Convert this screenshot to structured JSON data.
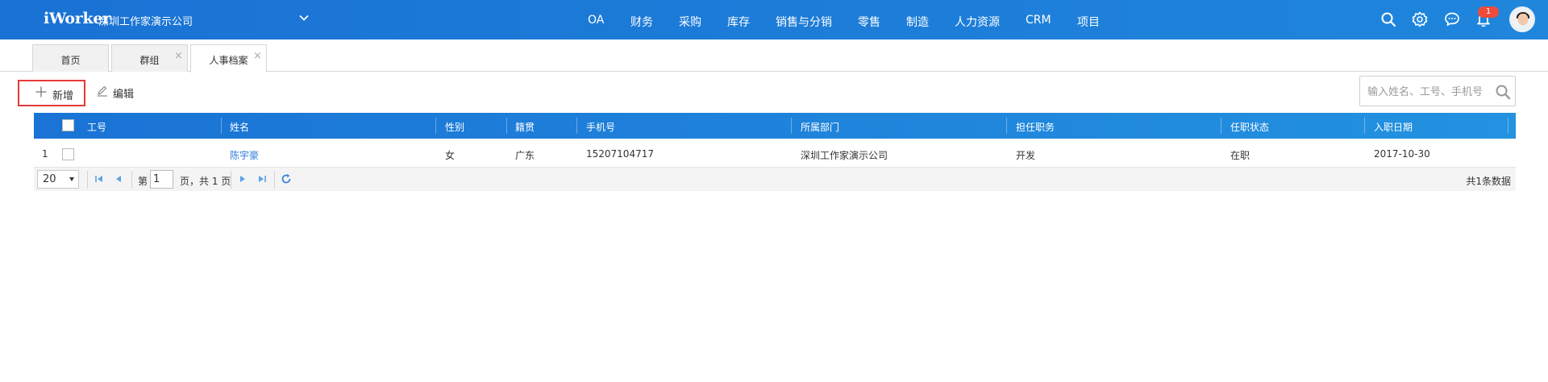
{
  "header": {
    "logo": "iWorker",
    "company": "深圳工作家演示公司",
    "nav": [
      "OA",
      "财务",
      "采购",
      "库存",
      "销售与分销",
      "零售",
      "制造",
      "人力资源",
      "CRM",
      "项目"
    ],
    "notification_count": "1",
    "colors": {
      "bar": "#1a72d4",
      "badge": "#f04b3a"
    }
  },
  "tabs": [
    {
      "label": "首页"
    },
    {
      "label": "群组"
    },
    {
      "label": "人事档案"
    }
  ],
  "toolbar": {
    "add_label": "新增",
    "edit_label": "编辑",
    "search_placeholder": "输入姓名、工号、手机号"
  },
  "grid": {
    "columns": [
      "工号",
      "姓名",
      "性别",
      "籍贯",
      "手机号",
      "所属部门",
      "担任职务",
      "任职状态",
      "入职日期"
    ],
    "rows": [
      {
        "index": "1",
        "emp_no": "",
        "name": "陈宇豪",
        "gender": "女",
        "hometown": "广东",
        "phone": "15207104717",
        "department": "深圳工作家演示公司",
        "position": "开发",
        "status": "在职",
        "join_date": "2017-10-30"
      }
    ]
  },
  "pager": {
    "page_size": "20",
    "page_prefix": "第",
    "page_value": "1",
    "page_suffix": "页，共 1 页",
    "total_text": "共1条数据"
  }
}
